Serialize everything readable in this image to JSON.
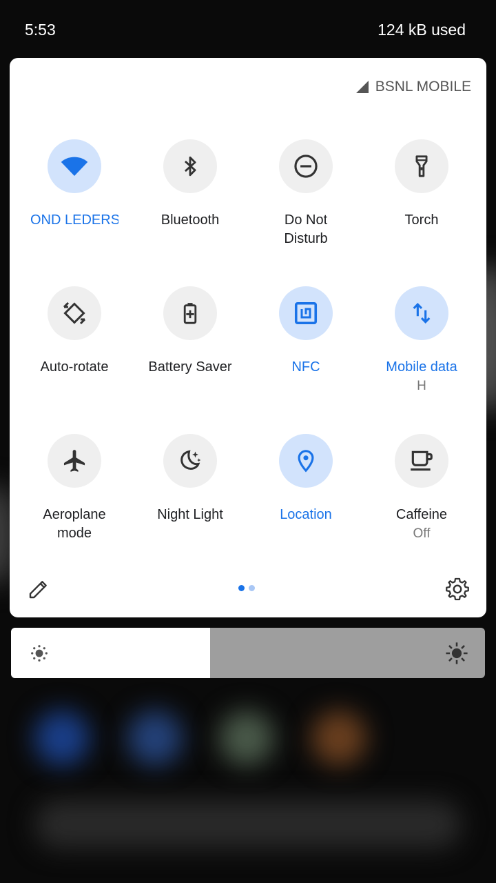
{
  "status_bar": {
    "time": "5:53",
    "data_usage": "124 kB used"
  },
  "carrier": {
    "name": "BSNL MOBILE",
    "icon": "signal-icon"
  },
  "tiles": [
    {
      "label": "OND LEDERS",
      "icon": "wifi-icon",
      "active": true
    },
    {
      "label": "Bluetooth",
      "icon": "bluetooth-icon",
      "active": false
    },
    {
      "label": "Do Not Disturb",
      "icon": "do-not-disturb-icon",
      "active": false
    },
    {
      "label": "Torch",
      "icon": "torch-icon",
      "active": false
    },
    {
      "label": "Auto-rotate",
      "icon": "auto-rotate-icon",
      "active": false
    },
    {
      "label": "Battery Saver",
      "icon": "battery-saver-icon",
      "active": false
    },
    {
      "label": "NFC",
      "icon": "nfc-icon",
      "active": true
    },
    {
      "label": "Mobile data",
      "sub": "H",
      "icon": "mobile-data-icon",
      "active": true
    },
    {
      "label": "Aeroplane mode",
      "icon": "airplane-icon",
      "active": false
    },
    {
      "label": "Night Light",
      "icon": "night-light-icon",
      "active": false
    },
    {
      "label": "Location",
      "icon": "location-icon",
      "active": true
    },
    {
      "label": "Caffeine",
      "sub": "Off",
      "icon": "coffee-cup-icon",
      "active": false
    }
  ],
  "footer": {
    "edit_icon": "pencil-icon",
    "settings_icon": "gear-icon",
    "pages": 2,
    "current_page": 1
  },
  "brightness": {
    "level": 0.42,
    "low_icon": "brightness-low-icon",
    "high_icon": "brightness-high-icon"
  },
  "colors": {
    "accent": "#1a73e8",
    "active_tile": "#d2e3fc",
    "inactive_tile": "#efefef"
  }
}
